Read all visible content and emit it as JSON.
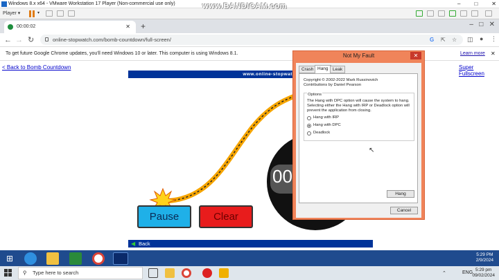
{
  "vm": {
    "title": "Windows 8.x x64 - VMware Workstation 17 Player (Non-commercial use only)",
    "player_label": "Player",
    "watermark": "www.BANDICAM.com"
  },
  "browser": {
    "tab_title": "00:00:02",
    "url": "online-stopwatch.com/bomb-countdown/full-screen/",
    "infobar_text": "To get future Google Chrome updates, you'll need Windows 10 or later. This computer is using Windows 8.1.",
    "learn_more": "Learn more"
  },
  "page": {
    "back_link": "< Back to Bomb Countdown",
    "fullscreen_link": "Super Fullscreen",
    "header": "www.online-stopwatch.com",
    "timer_partial": "00",
    "pause_label": "Pause",
    "clear_label": "Clear",
    "back_label": "Back"
  },
  "dialog": {
    "title": "Not My Fault",
    "tabs": [
      "Crash",
      "Hang",
      "Leak"
    ],
    "copyright": "Copyright © 2002-2022 Mark Russinovich",
    "contrib": "Contributions by Daniel Pearson",
    "options_label": "Options",
    "desc1": "The Hang with DPC option will cause the system to hang.",
    "desc2": "Selecting either the Hang with IRP or Deadlock option will",
    "desc3": "prevent the application from closing.",
    "options": [
      "Hang with IRP",
      "Hang with DPC",
      "Deadlock"
    ],
    "selected_option": "Hang with DPC",
    "hang_button": "Hang",
    "cancel_button": "Cancel"
  },
  "guest_clock": {
    "time": "5:29 PM",
    "date": "2/9/2024"
  },
  "host": {
    "search_placeholder": "Type here to search",
    "lang": "ENG",
    "time": "5:29 pm",
    "date": "09/02/2024"
  }
}
